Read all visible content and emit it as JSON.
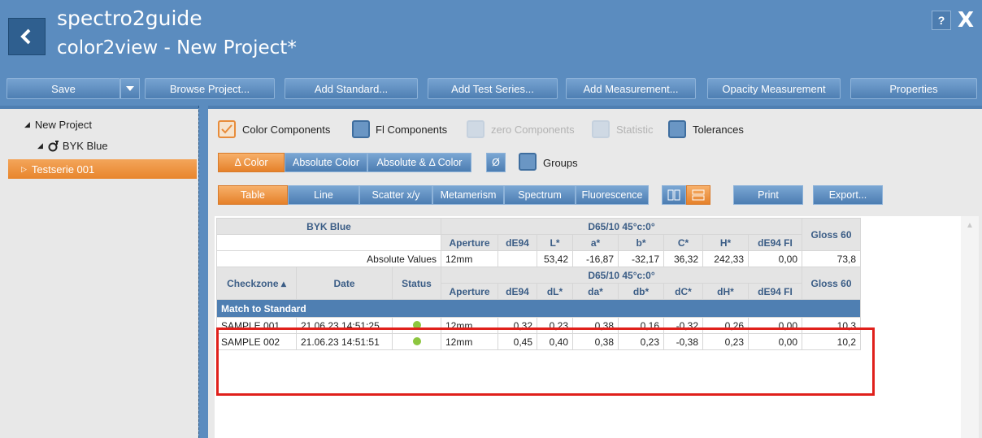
{
  "header": {
    "app_title": "spectro2guide",
    "project_title": "color2view - New Project*",
    "help_label": "?",
    "close_label": "X"
  },
  "toolbar": {
    "save": "Save",
    "browse": "Browse Project...",
    "add_standard": "Add Standard...",
    "add_test_series": "Add Test Series...",
    "add_measurement": "Add Measurement...",
    "opacity": "Opacity Measurement",
    "properties": "Properties"
  },
  "tree": {
    "root": "New Project",
    "standard": "BYK Blue",
    "series": "Testserie 001"
  },
  "options": {
    "color_components": "Color Components",
    "fl_components": "Fl Components",
    "zero_components": "zero Components",
    "statistic": "Statistic",
    "tolerances": "Tolerances",
    "groups": "Groups",
    "empty_symbol": "Ø"
  },
  "color_modes": [
    "Δ Color",
    "Absolute Color",
    "Absolute & Δ Color"
  ],
  "views": {
    "table": "Table",
    "line": "Line",
    "scatter": "Scatter x/y",
    "metamerism": "Metamerism",
    "spectrum": "Spectrum",
    "fluorescence": "Fluorescence",
    "print": "Print",
    "export": "Export..."
  },
  "table": {
    "standard_name": "BYK Blue",
    "illuminant": "D65/10  45°c:0°",
    "gloss": "Gloss 60",
    "abs_headers": [
      "Aperture",
      "dE94",
      "L*",
      "a*",
      "b*",
      "C*",
      "H*",
      "dE94 FI"
    ],
    "abs_label": "Absolute Values",
    "abs_values": [
      "12mm",
      "",
      "53,42",
      "-16,87",
      "-32,17",
      "36,32",
      "242,33",
      "0,00",
      "73,8"
    ],
    "checkzone": "Checkzone ▴",
    "date": "Date",
    "status": "Status",
    "delta_headers": [
      "Aperture",
      "dE94",
      "dL*",
      "da*",
      "db*",
      "dC*",
      "dH*",
      "dE94 FI"
    ],
    "match_label": "Match to Standard",
    "rows": [
      [
        "SAMPLE 001",
        "21.06.23 14:51:25",
        "12mm",
        "0,32",
        "0,23",
        "0,38",
        "0,16",
        "-0,32",
        "0,26",
        "0,00",
        "10,3"
      ],
      [
        "SAMPLE 002",
        "21.06.23 14:51:51",
        "12mm",
        "0,45",
        "0,40",
        "0,38",
        "0,23",
        "-0,38",
        "0,23",
        "0,00",
        "10,2"
      ]
    ]
  }
}
